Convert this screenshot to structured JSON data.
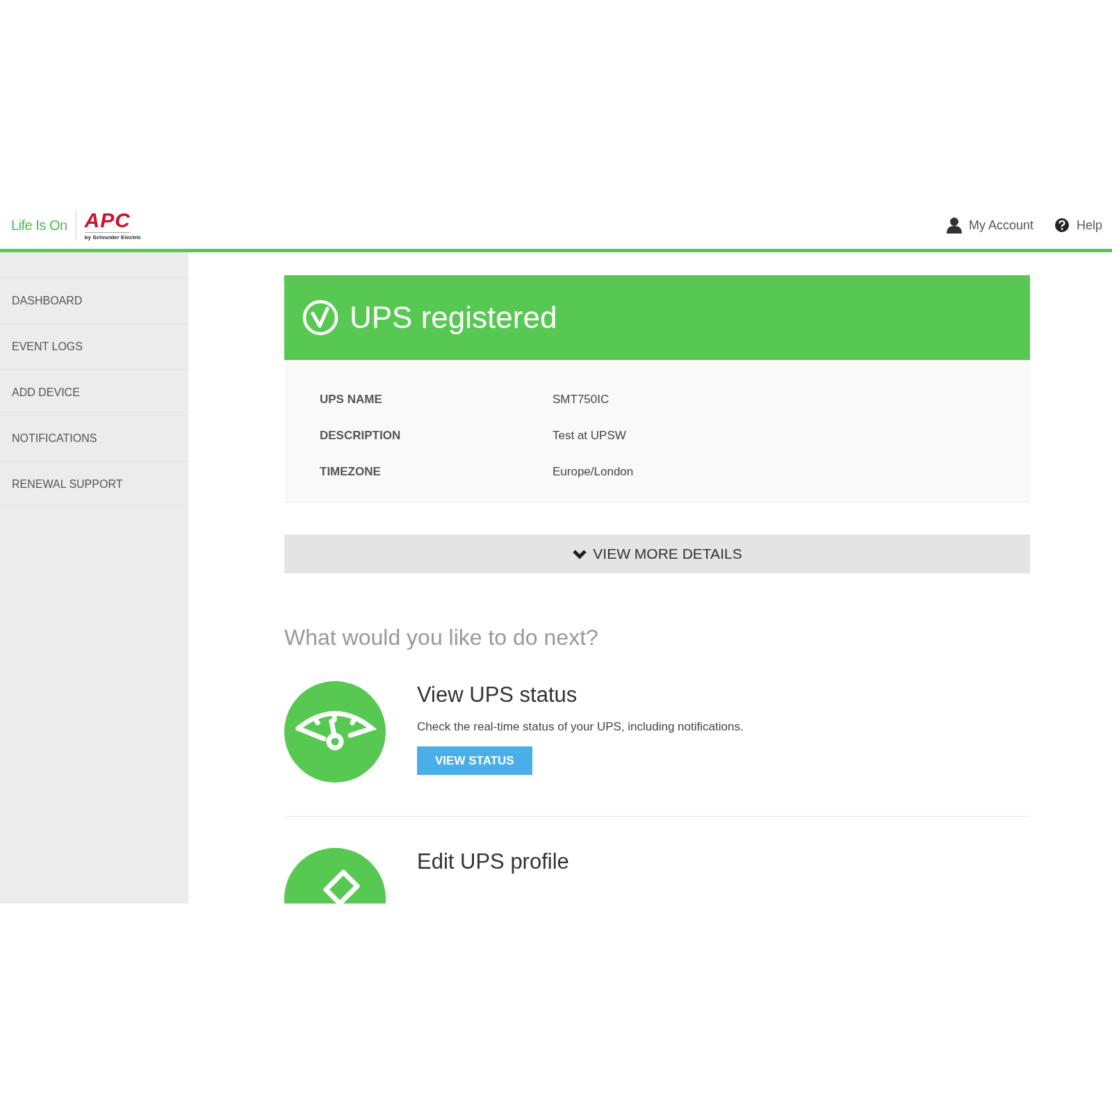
{
  "header": {
    "tagline": "Life Is On",
    "brand": "APC",
    "brand_sub": "by Schneider Electric",
    "links": [
      {
        "kind": "account",
        "label": "My Account"
      },
      {
        "kind": "help",
        "label": "Help"
      }
    ]
  },
  "sidebar": {
    "items": [
      {
        "label": "DASHBOARD"
      },
      {
        "label": "EVENT LOGS"
      },
      {
        "label": "ADD DEVICE"
      },
      {
        "label": "NOTIFICATIONS"
      },
      {
        "label": "RENEWAL SUPPORT"
      }
    ]
  },
  "banner": {
    "title": "UPS registered"
  },
  "details": [
    {
      "label": "UPS NAME",
      "value": "SMT750IC"
    },
    {
      "label": "DESCRIPTION",
      "value": "Test at UPSW"
    },
    {
      "label": "TIMEZONE",
      "value": "Europe/London"
    }
  ],
  "more_button": "VIEW MORE DETAILS",
  "next_heading": "What would you like to do next?",
  "actions": [
    {
      "kind": "status",
      "title": "View UPS status",
      "description": "Check the real-time status of your UPS, including notifications.",
      "button": "VIEW STATUS"
    },
    {
      "kind": "profile",
      "title": "Edit UPS profile"
    }
  ]
}
